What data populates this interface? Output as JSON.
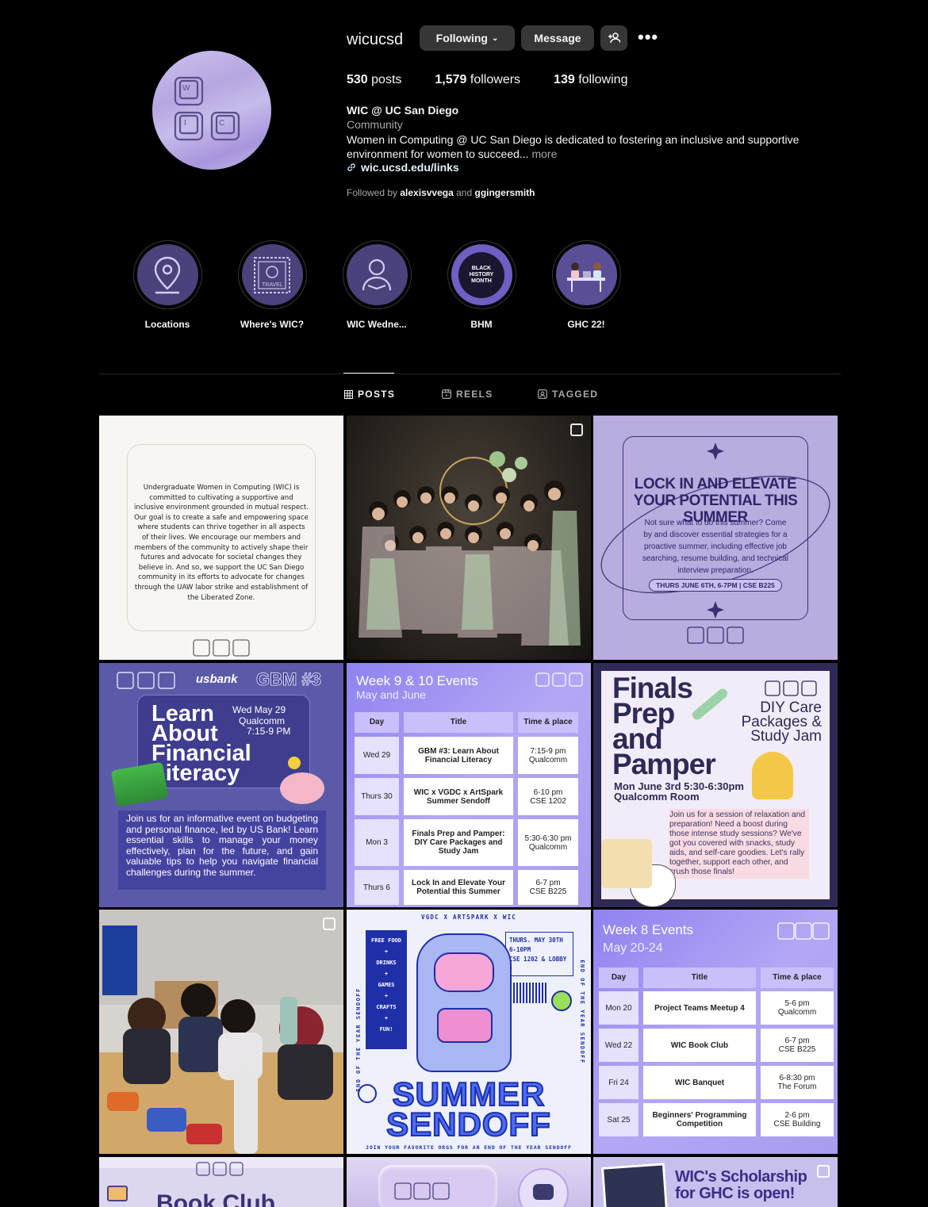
{
  "profile": {
    "username": "wicucsd",
    "following_label": "Following",
    "message_label": "Message",
    "posts_count": "530",
    "posts_label": "posts",
    "followers_count": "1,579",
    "followers_label": "followers",
    "following_count": "139",
    "following_stat_label": "following",
    "full_name": "WIC @ UC San Diego",
    "category": "Community",
    "bio": "Women in Computing @ UC San Diego is dedicated to fostering an inclusive and supportive environment for women to succeed...",
    "bio_more": "more",
    "link": "wic.ucsd.edu/links",
    "followed_by_prefix": "Followed by",
    "followed_by_1": "alexisvvega",
    "followed_by_and": "and",
    "followed_by_2": "ggingersmith"
  },
  "highlights": [
    {
      "label": "Locations",
      "icon": "map-pin-icon"
    },
    {
      "label": "Where's WIC?",
      "icon": "travel-stamp-icon"
    },
    {
      "label": "WIC Wedne...",
      "icon": "person-reading-icon"
    },
    {
      "label": "BHM",
      "icon": "black-history-month-icon"
    },
    {
      "label": "GHC 22!",
      "icon": "people-at-table-icon"
    }
  ],
  "tabs": {
    "posts": "POSTS",
    "reels": "REELS",
    "tagged": "TAGGED"
  },
  "posts": {
    "p1": {
      "text": "Undergraduate Women in Computing (WIC) is committed to cultivating a supportive and inclusive environment grounded in mutual respect. Our goal is to create a safe and empowering space where students can thrive together in all aspects of their lives. We encourage our members and members of the community to actively shape their futures and advocate for societal changes they believe in. And so, we support the UC San Diego community in its efforts to advocate for changes through the UAW labor strike and establishment of the Liberated Zone."
    },
    "p3": {
      "title": "LOCK IN AND ELEVATE YOUR POTENTIAL THIS SUMMER",
      "body": "Not sure what to do this summer? Come by and discover essential strategies for a proactive summer, including effective job searching, resume building, and technical interview preparation.",
      "when": "THURS JUNE 6TH, 6-7PM | CSE B225"
    },
    "p4": {
      "sponsor": "usbank",
      "gbm": "GBM #3",
      "title": "Learn About Financial Literacy",
      "date": "Wed May 29",
      "place": "Qualcomm",
      "time": "7:15-9 PM",
      "body": "Join us for an informative event on budgeting and personal finance, led by US Bank! Learn essential skills to manage your money effectively, plan for the future, and gain valuable tips to help you navigate financial challenges during the summer."
    },
    "p5": {
      "title": "Week 9 & 10 Events",
      "subtitle": "May and June",
      "headers": [
        "Day",
        "Title",
        "Time & place"
      ],
      "rows": [
        {
          "day": "Wed 29",
          "title": "GBM #3: Learn About Financial Literacy",
          "time": "7:15-9 pm",
          "place": "Qualcomm"
        },
        {
          "day": "Thurs 30",
          "title": "WIC x VGDC x ArtSpark Summer Sendoff",
          "time": "6-10 pm",
          "place": "CSE 1202"
        },
        {
          "day": "Mon 3",
          "title": "Finals Prep and Pamper: DIY Care Packages and Study Jam",
          "time": "5:30-6:30 pm",
          "place": "Qualcomm"
        },
        {
          "day": "Thurs 6",
          "title": "Lock In and Elevate Your Potential this Summer",
          "time": "6-7 pm",
          "place": "CSE B225"
        }
      ]
    },
    "p6": {
      "title": "Finals Prep and Pamper",
      "subtitle": "DIY Care Packages & Study Jam",
      "when": "Mon June 3rd 5:30-6:30pm",
      "where": "Qualcomm Room",
      "body": "Join us for a session of relaxation and preparation! Need a boost during those intense study sessions? We've got you covered with snacks, study aids, and self-care goodies. Let's rally together, support each other, and crush those finals!"
    },
    "p8": {
      "top": "VGDC X ARTSPARK X WIC",
      "side_list": [
        "FREE FOOD",
        "+",
        "DRINKS",
        "+",
        "GAMES",
        "+",
        "CRAFTS",
        "+",
        "FUN!"
      ],
      "when": "THURS. MAY 30TH",
      "time": "6-10PM",
      "where": "CSE 1202 & LOBBY",
      "side_text": "END OF THE YEAR SENDOFF",
      "title1": "SUMMER",
      "title2": "SENDOFF",
      "bottom": "JOIN YOUR FAVORITE ORGS FOR AN END OF THE YEAR SENDOFF"
    },
    "p9": {
      "title": "Week 8 Events",
      "subtitle": "May 20-24",
      "headers": [
        "Day",
        "Title",
        "Time & place"
      ],
      "rows": [
        {
          "day": "Mon 20",
          "title": "Project Teams Meetup 4",
          "time": "5-6 pm",
          "place": "Qualcomm"
        },
        {
          "day": "Wed 22",
          "title": "WIC Book Club",
          "time": "6-7 pm",
          "place": "CSE B225"
        },
        {
          "day": "Fri 24",
          "title": "WIC Banquet",
          "time": "6-8:30 pm",
          "place": "The Forum"
        },
        {
          "day": "Sat 25",
          "title": "Beginners' Programming Competition",
          "time": "2-6 pm",
          "place": "CSE Building"
        }
      ]
    },
    "p10": {
      "title": "Book Club"
    },
    "p12": {
      "title1": "WIC's Scholarship",
      "title2": "for GHC is open!"
    }
  },
  "colors": {
    "background": "#000000",
    "button": "#363636",
    "muted": "#a8a8a8",
    "lavender": "#b9acdf",
    "purple": "#6a5fb5"
  }
}
